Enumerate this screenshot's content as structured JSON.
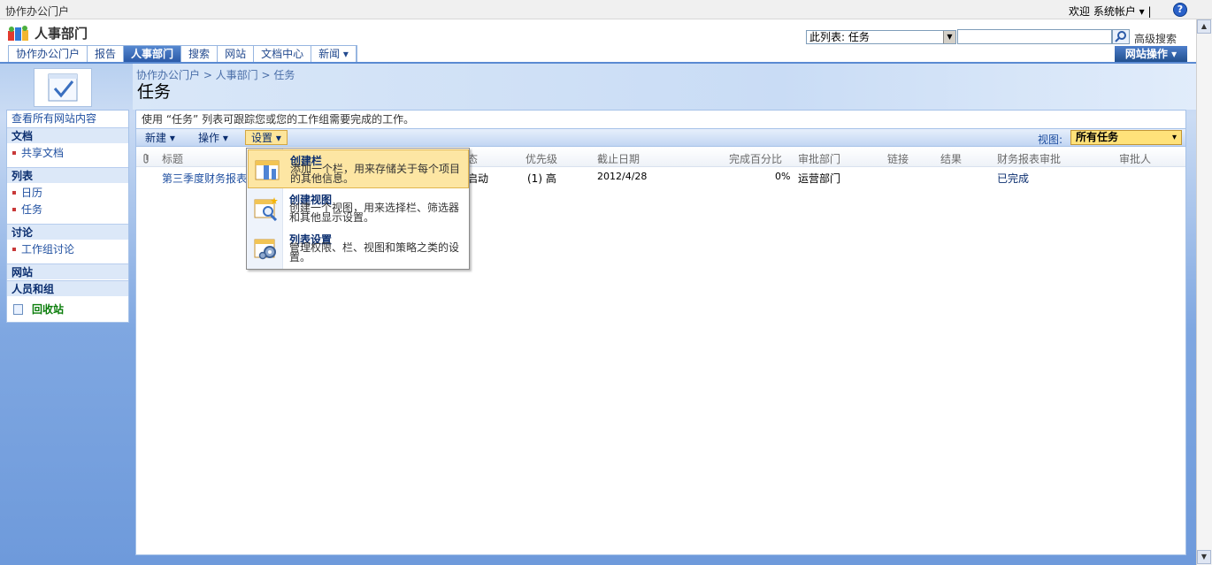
{
  "topbar": {
    "portal_link": "协作办公门户",
    "welcome": "欢迎 系统帐户 ▾ |",
    "help": "?"
  },
  "header": {
    "site_title": "人事部门",
    "scope_select": "此列表: 任务",
    "advanced_search": "高级搜索",
    "site_actions": "网站操作 ▾"
  },
  "nav": {
    "tabs": [
      {
        "label": "协作办公门户"
      },
      {
        "label": "报告"
      },
      {
        "label": "人事部门"
      },
      {
        "label": "搜索"
      },
      {
        "label": "网站"
      },
      {
        "label": "文档中心"
      },
      {
        "label": "新闻 ▾"
      }
    ],
    "active": "人事部门"
  },
  "page": {
    "breadcrumb": "协作办公门户 > 人事部门 > 任务",
    "title": "任务",
    "description": "使用 “任务” 列表可跟踪您或您的工作组需要完成的工作。"
  },
  "leftnav": {
    "view_all": "查看所有网站内容",
    "documents": "文档",
    "shared_docs": "共享文档",
    "lists": "列表",
    "calendar": "日历",
    "tasks": "任务",
    "discussions": "讨论",
    "team_discussion": "工作组讨论",
    "sites": "网站",
    "people": "人员和组",
    "recycle_bin": "回收站"
  },
  "toolbar": {
    "new": "新建 ▾",
    "actions": "操作 ▾",
    "settings": "设置 ▾",
    "view_label": "视图:",
    "view_value": "所有任务",
    "view_arrow": "▾"
  },
  "table": {
    "columns": [
      "标题",
      "态",
      "优先级",
      "截止日期",
      "完成百分比",
      "审批部门",
      "链接",
      "结果",
      "财务报表审批",
      "审批人"
    ],
    "rows": [
      {
        "title": "第三季度财务报表",
        "status": "启动",
        "priority": "(1) 高",
        "due": "2012/4/28",
        "percent": "0%",
        "dept": "运营部门",
        "approval": "已完成"
      }
    ]
  },
  "menu": {
    "items": [
      {
        "title": "创建栏",
        "desc": "添加一个栏，用来存储关于每个项目的其他信息。"
      },
      {
        "title": "创建视图",
        "desc": "创建一个视图，用来选择栏、筛选器和其他显示设置。"
      },
      {
        "title": "列表设置",
        "desc": "管理权限、栏、视图和策略之类的设置。"
      }
    ]
  },
  "colors": {
    "nav_blue": "#2b5aa8",
    "highlight": "#fde6a3",
    "link": "#1f4fa0",
    "done_green": "#0a7d0a"
  }
}
